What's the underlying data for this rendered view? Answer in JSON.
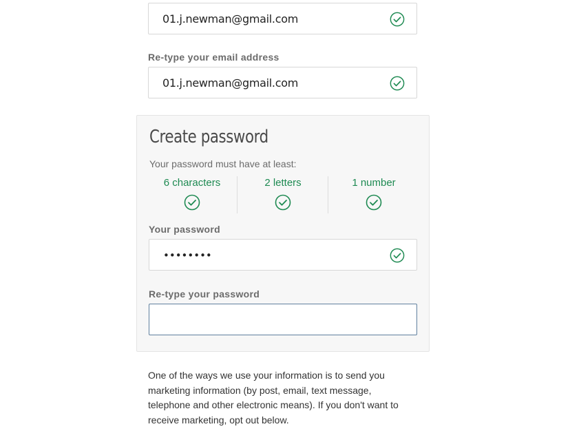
{
  "email": {
    "value": "01.j.newman@gmail.com",
    "valid_icon": "check-circle-icon"
  },
  "confirm_email": {
    "label": "Re-type your email address",
    "value": "01.j.newman@gmail.com",
    "valid_icon": "check-circle-icon"
  },
  "create_password": {
    "title": "Create password",
    "intro": "Your password must have at least:",
    "requirements": [
      {
        "label": "6 characters",
        "met": true
      },
      {
        "label": "2 letters",
        "met": true
      },
      {
        "label": "1 number",
        "met": true
      }
    ],
    "password_label": "Your password",
    "password_value": "••••••••",
    "retype_label": "Re-type your password",
    "retype_value": ""
  },
  "marketing_notice": "One of the ways we use your information is to send you marketing information (by post, email, text message, telephone and other electronic means). If you don't want to receive marketing, opt out below.",
  "colors": {
    "success_green": "#1e8a52",
    "focus_border": "#5f7f9e",
    "panel_bg": "#f7f7f7"
  }
}
